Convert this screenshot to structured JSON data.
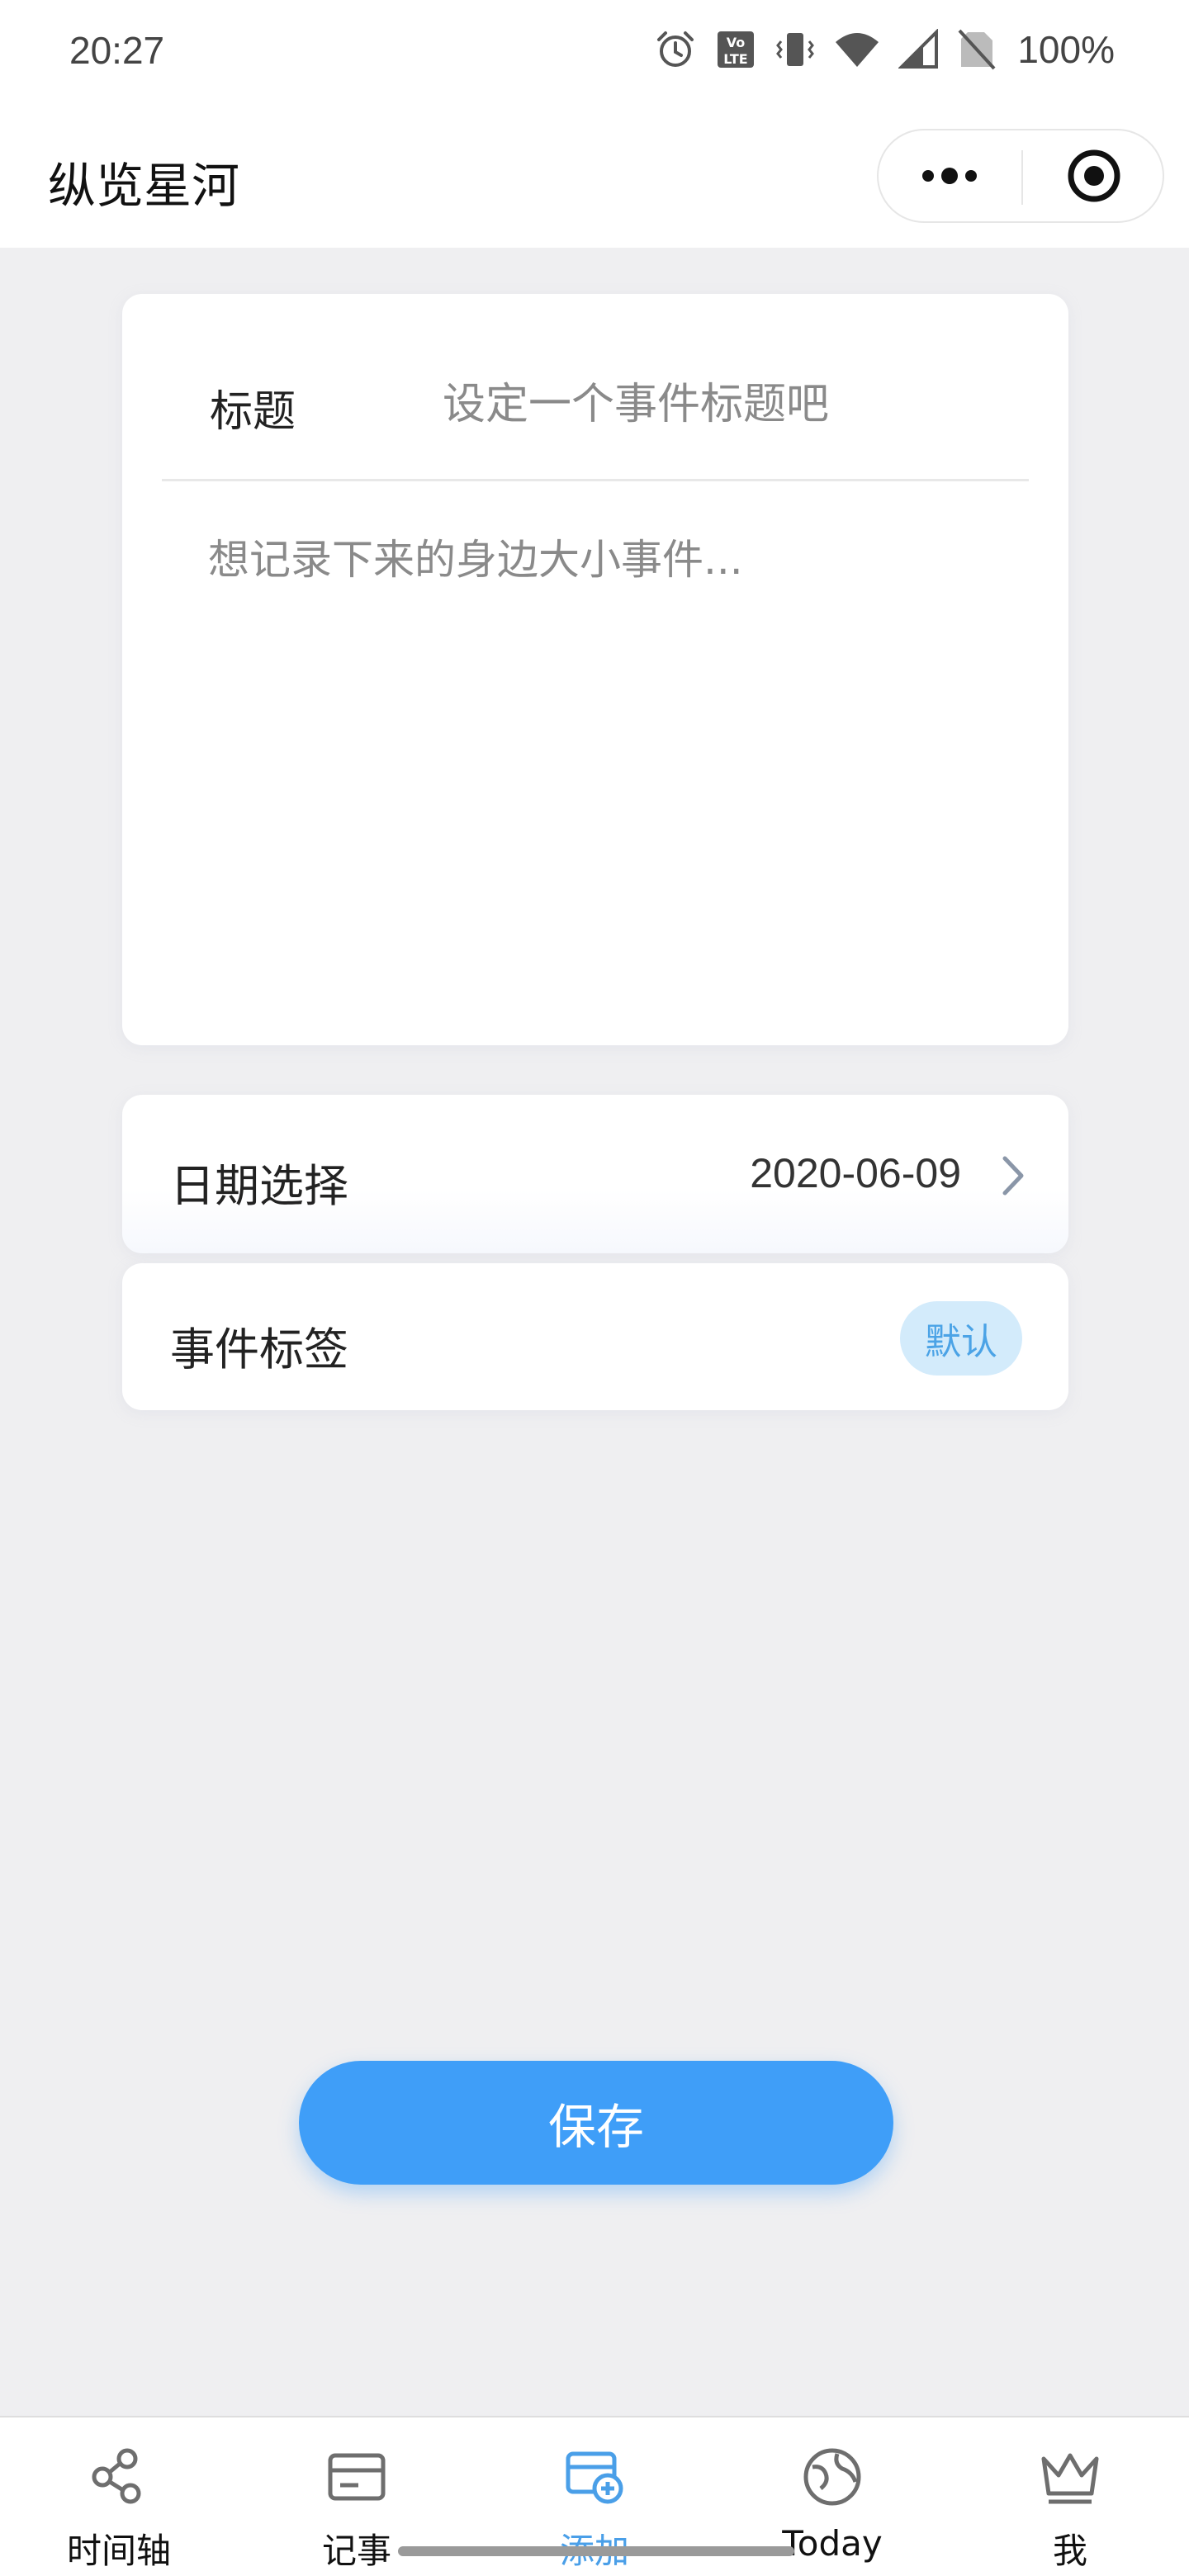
{
  "status_bar": {
    "time": "20:27",
    "battery": "100%",
    "icons": [
      "alarm-icon",
      "volte-icon",
      "vibrate-icon",
      "wifi-icon",
      "signal-icon",
      "no-sim-icon"
    ]
  },
  "nav": {
    "title": "纵览星河",
    "more_icon": "more-dots-icon",
    "close_icon": "target-close-icon"
  },
  "editor": {
    "title_label": "标题",
    "title_placeholder": "设定一个事件标题吧",
    "title_value": "",
    "content_placeholder": "想记录下来的身边大小事件...",
    "content_value": ""
  },
  "date_row": {
    "label": "日期选择",
    "value": "2020-06-09",
    "icon": "chevron-right-icon"
  },
  "tag_row": {
    "label": "事件标签",
    "tag": "默认"
  },
  "save_label": "保存",
  "tabs": [
    {
      "label": "时间轴",
      "icon": "share-nodes-icon",
      "active": false
    },
    {
      "label": "记事",
      "icon": "card-icon",
      "active": false
    },
    {
      "label": "添加",
      "icon": "add-card-icon",
      "active": true
    },
    {
      "label": "Today",
      "icon": "globe-icon",
      "active": false
    },
    {
      "label": "我",
      "icon": "crown-icon",
      "active": false
    }
  ],
  "colors": {
    "accent": "#3f9ef8",
    "tab_active": "#4a9fe8",
    "tag_bg": "#d3ebfb",
    "tag_text": "#4ba3e6",
    "background": "#efeff1"
  }
}
